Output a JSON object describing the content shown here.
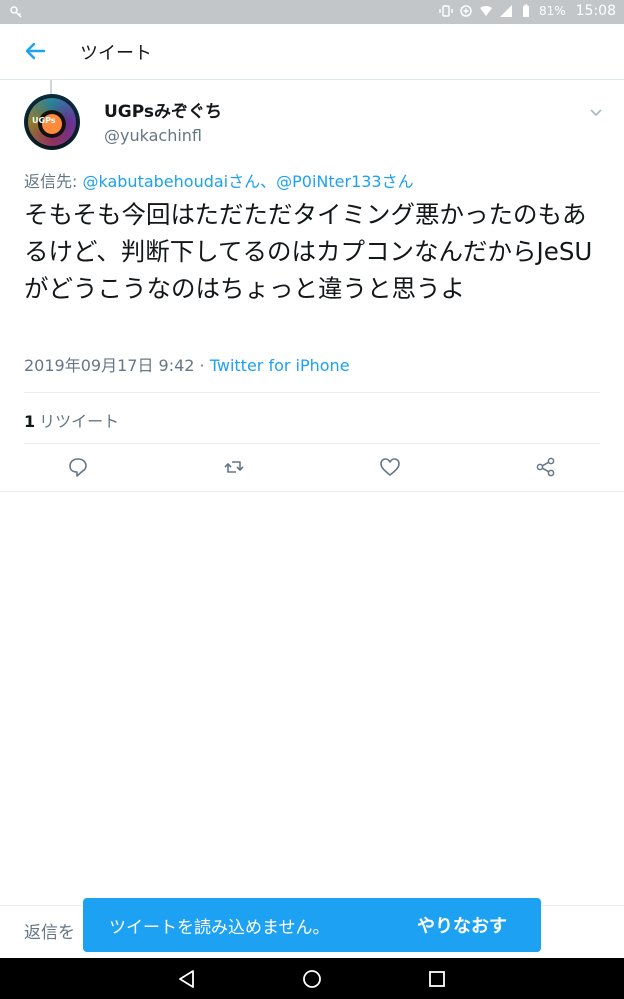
{
  "status_bar": {
    "battery": "81%",
    "time": "15:08"
  },
  "header": {
    "title": "ツイート"
  },
  "tweet": {
    "display_name": "UGPsみぞぐち",
    "handle": "@yukachinfl",
    "avatar_text": "UGPs",
    "replying_prefix": "返信先: ",
    "replying_mentions": "@kabutabehoudaiさん、@P0iNter133さん",
    "body": "そもそも今回はただただタイミング悪かったのもあるけど、判断下してるのはカプコンなんだからJeSUがどうこうなのはちょっと違うと思うよ",
    "date": "2019年09月17日 9:42",
    "separator": " · ",
    "source": "Twitter for iPhone",
    "retweet_count": "1",
    "retweet_label": "リツイート"
  },
  "reply_bar": {
    "placeholder_visible": "返信を"
  },
  "toast": {
    "message": "ツイートを読み込めません。",
    "action": "やりなおす"
  },
  "icons": {
    "back": "back-arrow-icon",
    "reply": "reply-icon",
    "retweet": "retweet-icon",
    "like": "heart-icon",
    "share": "share-icon"
  },
  "colors": {
    "accent": "#1da1f2",
    "secondary_text": "#657786"
  }
}
